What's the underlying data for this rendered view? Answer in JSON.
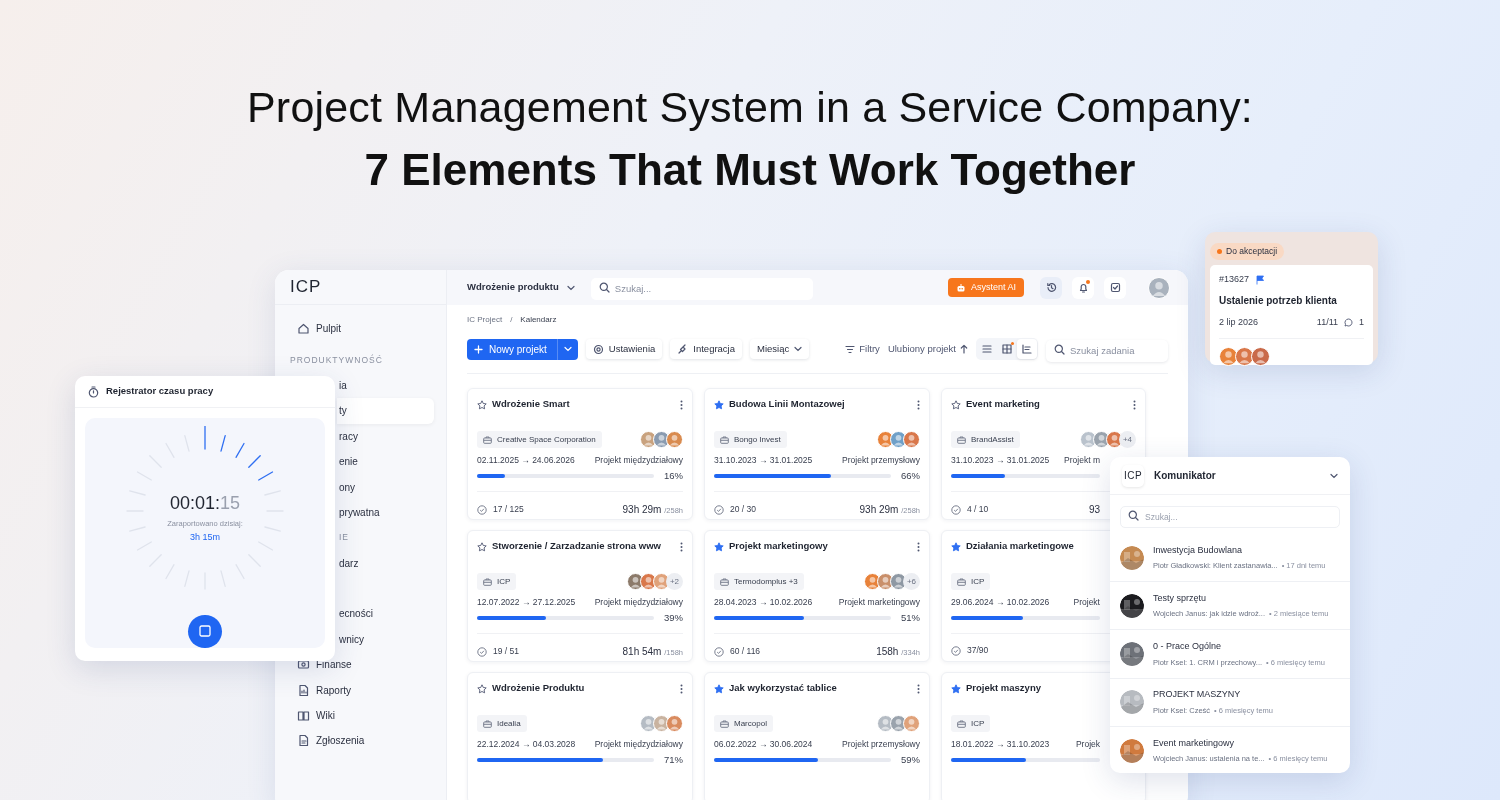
{
  "headline": {
    "line1": "Project Management System in a Service Company:",
    "line2": "7 Elements That Must Work Together"
  },
  "app": {
    "logo": "ICP",
    "sidebar": [
      {
        "kind": "home",
        "label": "Pulpit",
        "selected": false
      },
      {
        "kind": "section",
        "label": "PRODUKTYWNOŚĆ"
      },
      {
        "kind": "covered",
        "label": "ia",
        "selected": false
      },
      {
        "kind": "covered",
        "label": "ty",
        "selected": true
      },
      {
        "kind": "covered",
        "label": "racy",
        "selected": false
      },
      {
        "kind": "covered",
        "label": "enie",
        "selected": false
      },
      {
        "kind": "covered",
        "label": "ony",
        "selected": false
      },
      {
        "kind": "covered",
        "label": "prywatna",
        "selected": false
      },
      {
        "kind": "covered-section",
        "label": "IE"
      },
      {
        "kind": "covered",
        "label": "darz",
        "selected": false
      },
      {
        "kind": "covered",
        "label": "ecności",
        "selected": false,
        "gap_before": true
      },
      {
        "kind": "covered",
        "label": "wnicy",
        "selected": false
      },
      {
        "kind": "finance",
        "label": "Finanse",
        "selected": false
      },
      {
        "kind": "reports",
        "label": "Raporty",
        "selected": false
      },
      {
        "kind": "wiki",
        "label": "Wiki",
        "selected": false
      },
      {
        "kind": "requests",
        "label": "Zgłoszenia",
        "selected": false
      }
    ],
    "topbar": {
      "project": "Wdrożenie produktu",
      "search_placeholder": "Szukaj...",
      "ai_button": "Asystent AI",
      "bell_unread": true
    },
    "breadcrumb": {
      "items": [
        "IC Project",
        "Kalendarz"
      ],
      "separator": "/"
    },
    "toolbar": {
      "new_button": "Nowy projekt",
      "buttons": [
        {
          "kind": "settings",
          "label": "Ustawienia"
        },
        {
          "kind": "plug",
          "label": "Integracja"
        }
      ],
      "period": "Miesiąc",
      "filters": "Filtry",
      "sort": "Ulubiony projekt",
      "views": [
        {
          "kind": "list",
          "selected": false,
          "dot": false
        },
        {
          "kind": "grid",
          "selected": false,
          "dot": true
        },
        {
          "kind": "board",
          "selected": true,
          "dot": false
        }
      ],
      "search_placeholder": "Szukaj zadania"
    },
    "cards": [
      {
        "title": "Wdrożenie Smart",
        "starred": false,
        "client": "Creative Space Corporation",
        "avatars": [
          {
            "color": "#c9a27e"
          },
          {
            "color": "#8a9bb0"
          },
          {
            "color": "#d98b4f"
          }
        ],
        "dates": "02.11.2025 → 24.06.2026",
        "type": "Projekt międzydziałowy",
        "level": 0.16,
        "percent": "16%",
        "tasks": "17 / 125",
        "hours": "93h 29m",
        "budget": "/258h",
        "clip": false
      },
      {
        "title": "Budowa Linii Montazowej",
        "starred": true,
        "client": "Bongo Invest",
        "avatars": [
          {
            "color": "#e8823a"
          },
          {
            "color": "#6fa0c8"
          },
          {
            "color": "#d9774a"
          }
        ],
        "dates": "31.10.2023 → 31.01.2025",
        "type": "Projekt przemysłowy",
        "level": 0.66,
        "percent": "66%",
        "tasks": "20 / 30",
        "hours": "93h 29m",
        "budget": "/258h",
        "clip": false
      },
      {
        "title": "Event marketing",
        "starred": false,
        "client": "BrandAssist",
        "avatars": [
          {
            "color": "#b9c2cc"
          },
          {
            "color": "#9aa3ad"
          },
          {
            "color": "#d9774a"
          }
        ],
        "more": "+4",
        "dates": "31.10.2023 → 31.01.2025",
        "type": "Projekt m",
        "level": 0.36,
        "tasks": "4 / 10",
        "hours": "93",
        "clip": true
      },
      {
        "title": "Stworzenie / Zarzadzanie strona www",
        "starred": false,
        "client": "ICP",
        "avatars": [
          {
            "color": "#8c7a6a"
          },
          {
            "color": "#d9774a"
          },
          {
            "color": "#e0a27a"
          }
        ],
        "more": "+2",
        "dates": "12.07.2022 → 27.12.2025",
        "type": "Projekt międzydziałowy",
        "level": 0.39,
        "percent": "39%",
        "tasks": "19 / 51",
        "hours": "81h 54m",
        "budget": "/158h",
        "clip": false
      },
      {
        "title": "Projekt marketingowy",
        "starred": true,
        "client": "Termodomplus +3",
        "avatars": [
          {
            "color": "#e8823a"
          },
          {
            "color": "#c98f6a"
          },
          {
            "color": "#8e98a3"
          }
        ],
        "more": "+6",
        "dates": "28.04.2023 → 10.02.2026",
        "type": "Projekt marketingowy",
        "level": 0.51,
        "percent": "51%",
        "tasks": "60 / 116",
        "hours": "158h",
        "budget": "/334h",
        "clip": false
      },
      {
        "title": "Działania marketingowe",
        "starred": true,
        "client": "ICP",
        "dates": "29.06.2024 → 10.02.2026",
        "type": "Projekt",
        "level": 0.48,
        "tasks": "37/90",
        "clip": true
      },
      {
        "title": "Wdrożenie Produktu",
        "starred": false,
        "client": "Idealia",
        "avatars": [
          {
            "color": "#b5bcc4"
          },
          {
            "color": "#c9b3a0"
          },
          {
            "color": "#d98b5f"
          }
        ],
        "dates": "22.12.2024 → 04.03.2028",
        "type": "Projekt międzydziałowy",
        "level": 0.71,
        "percent": "71%",
        "clip": false
      },
      {
        "title": "Jak wykorzystać tablice",
        "starred": true,
        "client": "Marcopol",
        "avatars": [
          {
            "color": "#b5bcc4"
          },
          {
            "color": "#9aa3ad"
          },
          {
            "color": "#e0a27a"
          }
        ],
        "dates": "06.02.2022 → 30.06.2024",
        "type": "Projekt przemysłowy",
        "level": 0.59,
        "percent": "59%",
        "clip": false
      },
      {
        "title": "Projekt maszyny",
        "starred": true,
        "client": "ICP",
        "dates": "18.01.2022 → 31.10.2023",
        "type": "Projek",
        "level": 0.5,
        "clip": true
      }
    ]
  },
  "timer": {
    "title": "Rejestrator czasu pracy",
    "time": "00:01:",
    "seconds": "15",
    "level": 0.21,
    "reported_label": "Zaraportowano dzisiaj:",
    "reported": "3h 15m"
  },
  "task": {
    "status": "Do akceptacji",
    "number": "#13627",
    "flagged": true,
    "title": "Ustalenie potrzeb klienta",
    "date": "2 lip 2026",
    "progress": "11/11",
    "comments": "1",
    "avatars": [
      {
        "color": "#e8823a"
      },
      {
        "color": "#d9774a"
      },
      {
        "color": "#c96a4a"
      }
    ]
  },
  "messenger": {
    "logo": "ICP",
    "title": "Komunikator",
    "search_placeholder": "Szukaj...",
    "threads": [
      {
        "title": "Inwestycja Budowlana",
        "preview": "Piotr Gładkowski: Klient zastanawia...",
        "time": "• 17 dni temu",
        "color": "#c58a52"
      },
      {
        "title": "Testy sprzętu",
        "preview": "Wojciech Janus: jak idzie wdroż...",
        "time": "• 2 miesiące temu",
        "color": "#1b1b1f"
      },
      {
        "title": "0 - Prace Ogólne",
        "preview": "Piotr Ksel: 1. CRM i przechowy...",
        "time": "• 6 miesięcy temu",
        "color": "#6d7178"
      },
      {
        "title": "PROJEKT MASZYNY",
        "preview": "Piotr Ksel: Cześć",
        "time": "• 6 miesięcy temu",
        "color": "#b7bbc0"
      },
      {
        "title": "Event marketingowy",
        "preview": "Wojciech Janus: ustalenia na te...",
        "time": "• 6 miesięcy temu",
        "color": "#d07a3e"
      }
    ]
  }
}
